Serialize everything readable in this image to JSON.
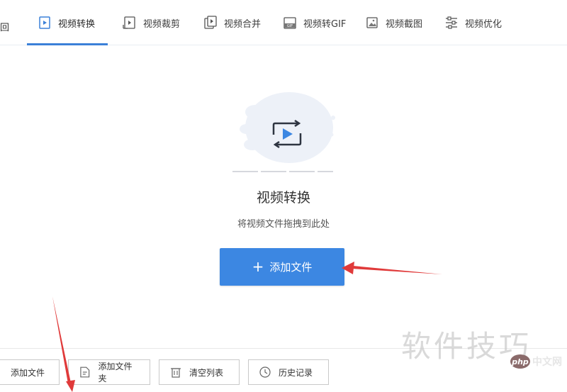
{
  "tabbar": {
    "back_label": "回",
    "tabs": [
      {
        "label": "视频转换",
        "icon": "video-convert-icon"
      },
      {
        "label": "视频裁剪",
        "icon": "video-cut-icon"
      },
      {
        "label": "视频合并",
        "icon": "video-merge-icon"
      },
      {
        "label": "视频转GIF",
        "icon": "video-gif-icon"
      },
      {
        "label": "视频截图",
        "icon": "video-screenshot-icon"
      },
      {
        "label": "视频优化",
        "icon": "video-optimize-icon"
      }
    ],
    "active_tab": 0
  },
  "main": {
    "title": "视频转换",
    "subtitle": "将视频文件拖拽到此处",
    "add_button_label": "添加文件"
  },
  "toolbar": {
    "add_file": "添加文件",
    "add_folder": "添加文件夹",
    "clear_list": "清空列表",
    "history": "历史记录"
  },
  "watermark": {
    "text": "软件技巧",
    "badge_logo": "php",
    "badge_text": "中文网"
  },
  "colors": {
    "accent": "#3c87e2",
    "tab_underline": "#3b80d8",
    "annotation_arrow": "#e03a3a"
  }
}
